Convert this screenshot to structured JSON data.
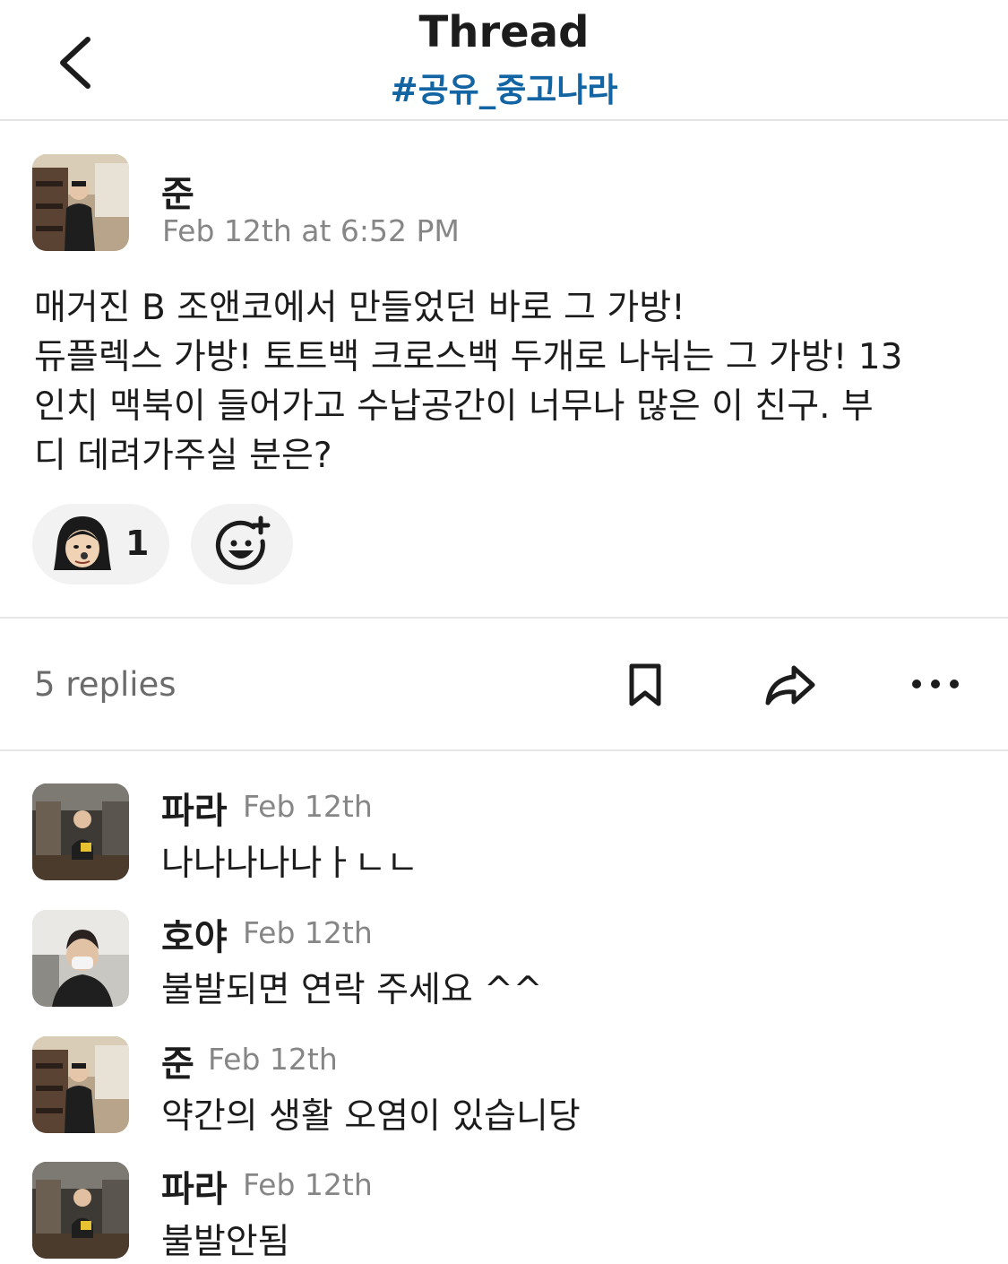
{
  "header": {
    "title": "Thread",
    "channel": "#공유_중고나라",
    "back_icon": "chevron-left-icon"
  },
  "message": {
    "author": "준",
    "timestamp": "Feb 12th at 6:52 PM",
    "lines": [
      "매거진 B 조앤코에서 만들었던 바로 그 가방!",
      "듀플렉스 가방! 토트백 크로스백 두개로 나눠는 그 가방! 13",
      "인치 맥북이 들어가고 수납공간이 너무나 많은 이 친구. 부",
      "디 데려가주실 분은?"
    ],
    "reactions": [
      {
        "icon": "custom-face-emoji-icon",
        "count": "1"
      }
    ],
    "add_reaction_icon": "add-reaction-icon"
  },
  "thread_bar": {
    "replies_label": "5 replies",
    "icons": [
      "bookmark-icon",
      "share-icon",
      "more-icon"
    ]
  },
  "replies": [
    {
      "author": "파라",
      "timestamp": "Feb 12th",
      "text": "나나나나나ㅏㄴㄴ"
    },
    {
      "author": "호야",
      "timestamp": "Feb 12th",
      "text": "불발되면 연락 주세요 ^^"
    },
    {
      "author": "준",
      "timestamp": "Feb 12th",
      "text": "약간의 생활 오염이 있습니당"
    },
    {
      "author": "파라",
      "timestamp": "Feb 12th",
      "text": "불발안됨"
    }
  ],
  "colors": {
    "channel_link": "#1264a3",
    "text": "#1d1c1d",
    "muted": "#868686",
    "pill_bg": "#f2f2f2"
  }
}
